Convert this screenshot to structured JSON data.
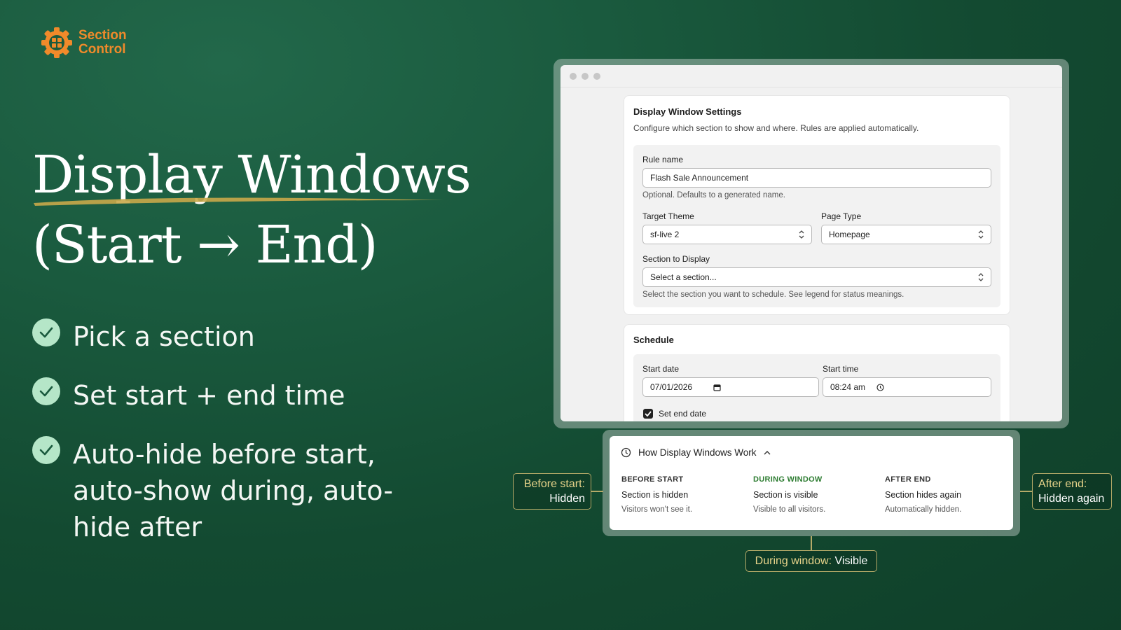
{
  "logo": {
    "line1": "Section",
    "line2": "Control",
    "icon": "gear-grid-icon",
    "color": "#f08a2a"
  },
  "hero": {
    "line1": "Display Windows",
    "line2": "(Start → End)"
  },
  "bullets": [
    {
      "text": "Pick a section",
      "icon": "check-icon"
    },
    {
      "text": "Set start + end time",
      "icon": "check-icon"
    },
    {
      "text": "Auto-hide before start, auto-show during, auto-hide after",
      "icon": "check-icon"
    }
  ],
  "settings": {
    "title": "Display Window Settings",
    "subtitle": "Configure which section to show and where. Rules are applied automatically.",
    "rule_name_label": "Rule name",
    "rule_name_value": "Flash Sale Announcement",
    "rule_name_help": "Optional. Defaults to a generated name.",
    "target_theme_label": "Target Theme",
    "target_theme_value": "sf-live 2",
    "page_type_label": "Page Type",
    "page_type_value": "Homepage",
    "section_label": "Section to Display",
    "section_value": "Select a section...",
    "section_help": "Select the section you want to schedule. See legend for status meanings."
  },
  "schedule": {
    "title": "Schedule",
    "start_date_label": "Start date",
    "start_date_value": "07/01/2026",
    "start_time_label": "Start time",
    "start_time_value": "08:24 am",
    "end_date_label": "Set end date",
    "end_date_checked": true
  },
  "legend": {
    "title": "How Display Windows Work",
    "columns": [
      {
        "caption": "BEFORE START",
        "main": "Section is hidden",
        "small": "Visitors won't see it.",
        "color": "#333333"
      },
      {
        "caption": "DURING WINDOW",
        "main": "Section is visible",
        "small": "Visible to all visitors.",
        "color": "#2e7d32"
      },
      {
        "caption": "AFTER END",
        "main": "Section hides again",
        "small": "Automatically hidden.",
        "color": "#333333"
      }
    ]
  },
  "callouts": {
    "before_key": "Before start:",
    "before_val": "Hidden",
    "after_key": "After end:",
    "after_val": "Hidden again",
    "during_key": "During window:",
    "during_val": "Visible"
  }
}
